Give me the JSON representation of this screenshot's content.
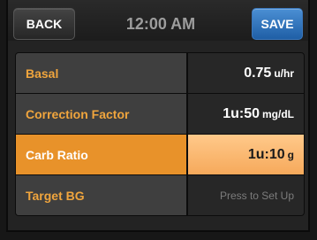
{
  "header": {
    "back_label": "BACK",
    "time": "12:00 AM",
    "save_label": "SAVE"
  },
  "rows": [
    {
      "label": "Basal",
      "value": "0.75",
      "unit": "u/hr"
    },
    {
      "label": "Correction Factor",
      "value": "1u:50",
      "unit": "mg/dL"
    },
    {
      "label": "Carb Ratio",
      "value": "1u:10",
      "unit": "g",
      "selected": true
    },
    {
      "label": "Target BG",
      "placeholder": "Press to Set Up"
    }
  ],
  "colors": {
    "accent_orange": "#f0a53d",
    "selected_label": "#e8922a",
    "selected_value": "#f6a95b",
    "save_blue": "#2d6fb8"
  }
}
